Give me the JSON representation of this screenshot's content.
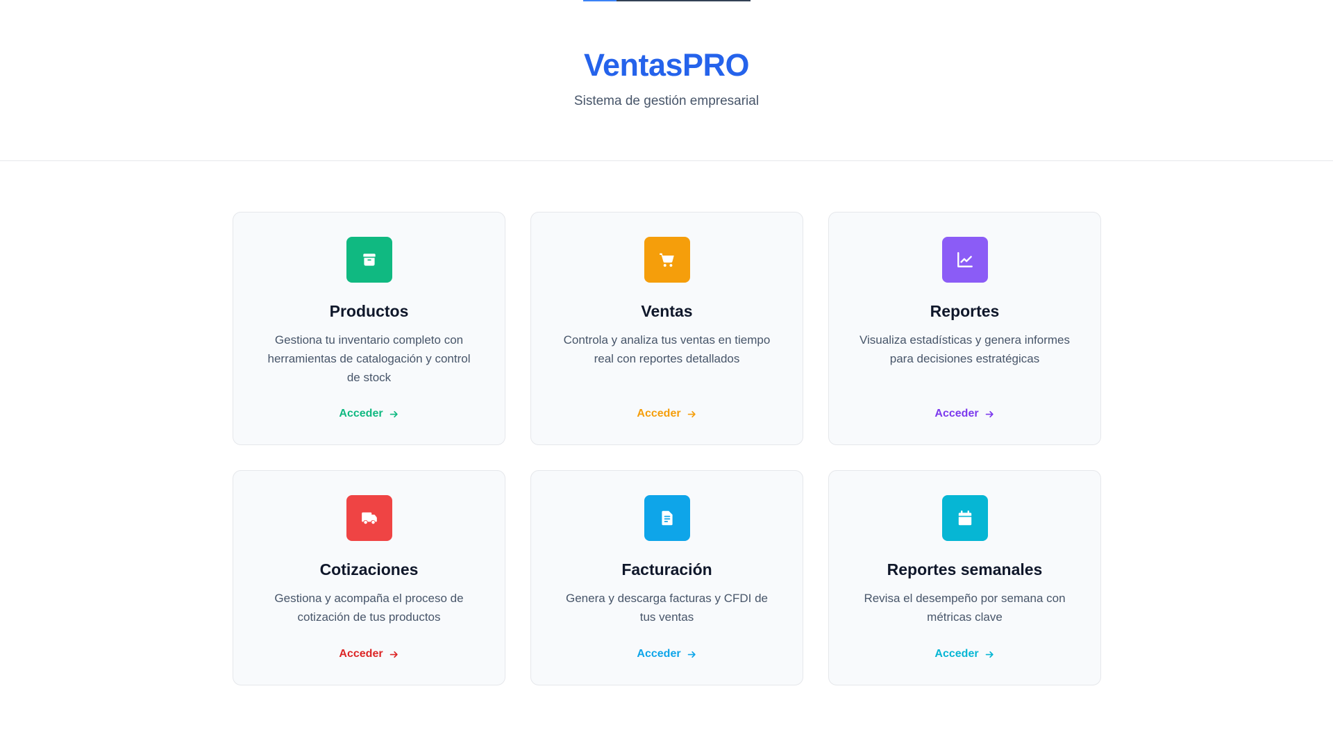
{
  "header": {
    "brand": "VentasPRO",
    "tagline": "Sistema de gestión empresarial"
  },
  "top_progress": {
    "fraction": 0.2
  },
  "cards": [
    {
      "title": "Productos",
      "description": "Gestiona tu inventario completo con herramientas de catalogación y control de stock",
      "link_label": "Acceder",
      "icon": "box-icon",
      "color": "#10b981"
    },
    {
      "title": "Ventas",
      "description": "Controla y analiza tus ventas en tiempo real con reportes detallados",
      "link_label": "Acceder",
      "icon": "cart-icon",
      "color": "#f59e0b"
    },
    {
      "title": "Reportes",
      "description": "Visualiza estadísticas y genera informes para decisiones estratégicas",
      "link_label": "Acceder",
      "icon": "chart-line-icon",
      "color": "#8b5cf6"
    },
    {
      "title": "Cotizaciones",
      "description": "Gestiona y acompaña el proceso de cotización de tus productos",
      "link_label": "Acceder",
      "icon": "truck-icon",
      "color": "#ef4444"
    },
    {
      "title": "Facturación",
      "description": "Genera y descarga facturas y CFDI de tus ventas",
      "link_label": "Acceder",
      "icon": "invoice-icon",
      "color": "#0ea5e9"
    },
    {
      "title": "Reportes semanales",
      "description": "Revisa el desempeño por semana con métricas clave",
      "link_label": "Acceder",
      "icon": "calendar-icon",
      "color": "#06b6d4"
    }
  ],
  "link_colors": [
    "#10b981",
    "#f59e0b",
    "#7c3aed",
    "#dc2626",
    "#0ea5e9",
    "#06b6d4"
  ]
}
